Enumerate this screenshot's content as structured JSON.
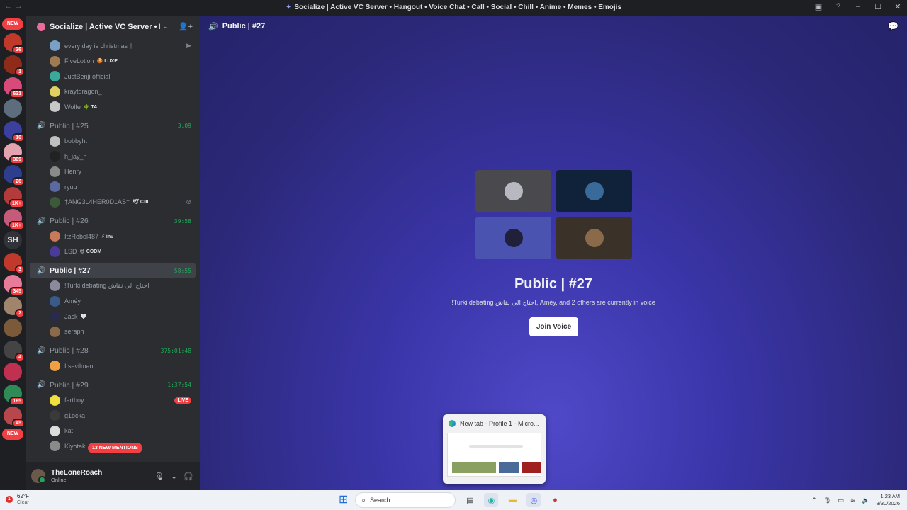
{
  "window": {
    "title": "Socialize | Active VC Server • Hangout • Voice Chat • Call • Social • Chill • Anime • Memes • Emojis"
  },
  "guilds": [
    {
      "type": "new",
      "label": "NEW"
    },
    {
      "badge": "36",
      "color": "#c0392b"
    },
    {
      "badge": "1",
      "color": "#8e2b1b"
    },
    {
      "badge": "631",
      "color": "#d84a7a"
    },
    {
      "badge": "",
      "color": "#5d6d7e"
    },
    {
      "badge": "10",
      "color": "#3b3f9e"
    },
    {
      "badge": "309",
      "color": "#e5a3b0"
    },
    {
      "badge": "26",
      "color": "#2d3e8f"
    },
    {
      "badge": "1K+",
      "color": "#b33b3b"
    },
    {
      "badge": "1K+",
      "color": "#c75a7a"
    },
    {
      "type": "sh",
      "label": "SH"
    },
    {
      "badge": "3",
      "color": "#c0392b"
    },
    {
      "badge": "345",
      "color": "#e87a9a"
    },
    {
      "badge": "2",
      "color": "#a0856c"
    },
    {
      "badge": "",
      "color": "#7a5a3a"
    },
    {
      "badge": "4",
      "color": "#444"
    },
    {
      "badge": "",
      "color": "#c03050"
    },
    {
      "badge": "165",
      "color": "#2e8b57"
    },
    {
      "badge": "45",
      "color": "#b8474d"
    },
    {
      "type": "new",
      "label": "NEW"
    }
  ],
  "server": {
    "name": "Socialize | Active VC Server • Han..."
  },
  "voice_channels": [
    {
      "name": "",
      "time": "",
      "users": [
        {
          "name": "every day is christmas †",
          "tag": "",
          "avatar": "#7aa0c8",
          "right": "cam"
        },
        {
          "name": "FiveLotion",
          "tag": "🍪 LUXE",
          "avatar": "#a07a50"
        },
        {
          "name": "JustBenji official",
          "tag": "",
          "avatar": "#3aa89a"
        },
        {
          "name": "kraytdragon_",
          "tag": "",
          "avatar": "#e0d060"
        },
        {
          "name": "Wolfe",
          "tag": "🌵 TA",
          "avatar": "#c8c8c8"
        }
      ]
    },
    {
      "name": "Public | #25",
      "time": "3:09",
      "users": [
        {
          "name": "bobbyht",
          "tag": "",
          "avatar": "#c0c0c0"
        },
        {
          "name": "h_jay_h",
          "tag": "",
          "avatar": "#222"
        },
        {
          "name": "Henry",
          "tag": "",
          "avatar": "#8a8a8a"
        },
        {
          "name": "ryuu",
          "tag": "",
          "avatar": "#5a6aa0"
        },
        {
          "name": "†ANG3L4HER0D1AS†",
          "tag": "🕊 CⅢ",
          "avatar": "#3a5a3a",
          "right": "mute"
        }
      ]
    },
    {
      "name": "Public | #26",
      "time": "39:58",
      "users": [
        {
          "name": "ItzRobol487",
          "tag": "⚡ inv",
          "avatar": "#c87a5a"
        },
        {
          "name": "LSD",
          "tag": "😊 CODM",
          "avatar": "#4a3a9a"
        }
      ]
    },
    {
      "name": "Public | #27",
      "time": "58:55",
      "active": true,
      "users": [
        {
          "name": "!Turki debating احتاج الى نقاش",
          "tag": "",
          "avatar": "#8a8a9a"
        },
        {
          "name": "Améy",
          "tag": "",
          "avatar": "#3a5a8a"
        },
        {
          "name": "Jack",
          "tag": "🤍",
          "avatar": "#2a2a4a"
        },
        {
          "name": "seraph",
          "tag": "",
          "avatar": "#8a6a4a"
        }
      ]
    },
    {
      "name": "Public | #28",
      "time": "375:01:48",
      "users": [
        {
          "name": "Itsevilman",
          "tag": "",
          "avatar": "#f0a040"
        }
      ]
    },
    {
      "name": "Public | #29",
      "time": "1:37:54",
      "users": [
        {
          "name": "fartboy",
          "tag": "",
          "avatar": "#f0e040",
          "right": "live"
        },
        {
          "name": "g1ocka",
          "tag": "",
          "avatar": "#3a3a3a"
        },
        {
          "name": "kat",
          "tag": "",
          "avatar": "#dcdcdc"
        },
        {
          "name": "Kiyotak",
          "tag": "",
          "avatar": "#8a8a8a"
        }
      ]
    }
  ],
  "mentions": "13 NEW MENTIONS",
  "live_label": "LIVE",
  "user_panel": {
    "name": "TheLoneRoach",
    "status": "Online"
  },
  "main": {
    "channel_title": "Public | #27",
    "voice_title": "Public | #27",
    "voice_subtitle": "!Turki debating احتاج الى نقاش, Améy, and 2 others are currently in voice",
    "join_label": "Join Voice",
    "tiles": [
      {
        "bg": "#4a4a4e",
        "avatar": "#b8b8c0"
      },
      {
        "bg": "#10223a",
        "avatar": "#3a6a9a"
      },
      {
        "bg": "#4a54b0",
        "avatar": "#20203a"
      },
      {
        "bg": "#3a3228",
        "avatar": "#8a6a4a"
      }
    ]
  },
  "preview": {
    "title": "New tab - Profile 1 - Micro..."
  },
  "taskbar": {
    "weather_temp": "62°F",
    "weather_cond": "Clear",
    "weather_badge": "1",
    "search_placeholder": "Search",
    "time": "1:23 AM",
    "date": "3/30/2026"
  }
}
